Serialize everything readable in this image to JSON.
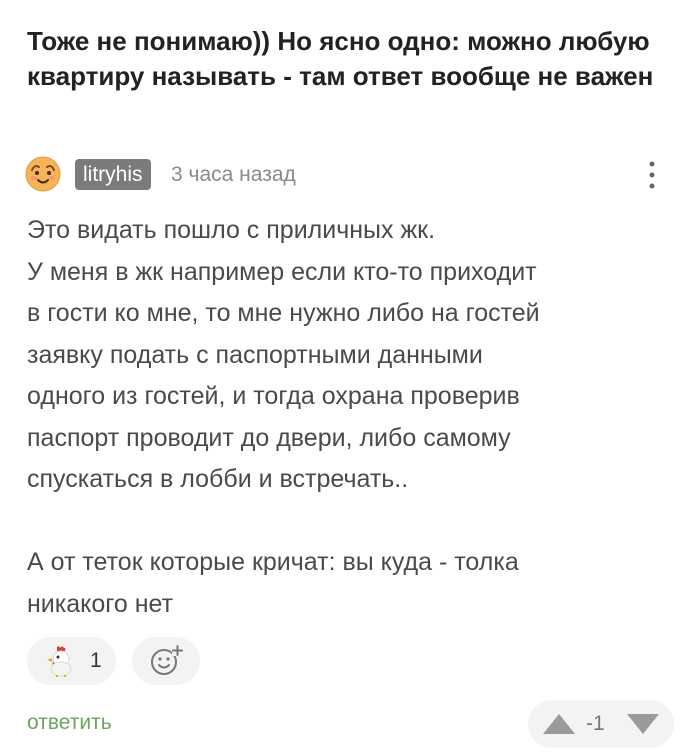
{
  "quote": {
    "text": "Тоже не понимаю)) Но ясно одно: можно любую квартиру называть - там ответ вообще не важен"
  },
  "comment": {
    "author": "litryhis",
    "time": "3 часа назад",
    "avatar_icon": "smiley-avatar-icon",
    "more_icon": "more-vertical-icon",
    "lines": [
      "Это видать пошло с приличных жк.",
      "У меня в жк например если кто-то приходит",
      "в гости ко мне, то мне нужно либо на гостей",
      "заявку подать с паспортными данными",
      "одного из гостей, и тогда охрана проверив",
      "паспорт проводит до двери, либо самому",
      "спускаться в лобби и встречать.."
    ],
    "lines2": [
      "А от теток которые кричат: вы куда - толка",
      "никакого нет"
    ]
  },
  "reactions": {
    "chicken_icon": "chicken-reaction-icon",
    "chicken_count": "1",
    "add_icon": "add-reaction-icon"
  },
  "actions": {
    "reply_label": "ответить"
  },
  "votes": {
    "value": "-1",
    "up_icon": "arrow-up-icon",
    "down_icon": "arrow-down-icon"
  },
  "colors": {
    "reply_green": "#6ea35d",
    "username_bg": "#7b7b7b",
    "pill_bg": "#f3f3f3"
  }
}
